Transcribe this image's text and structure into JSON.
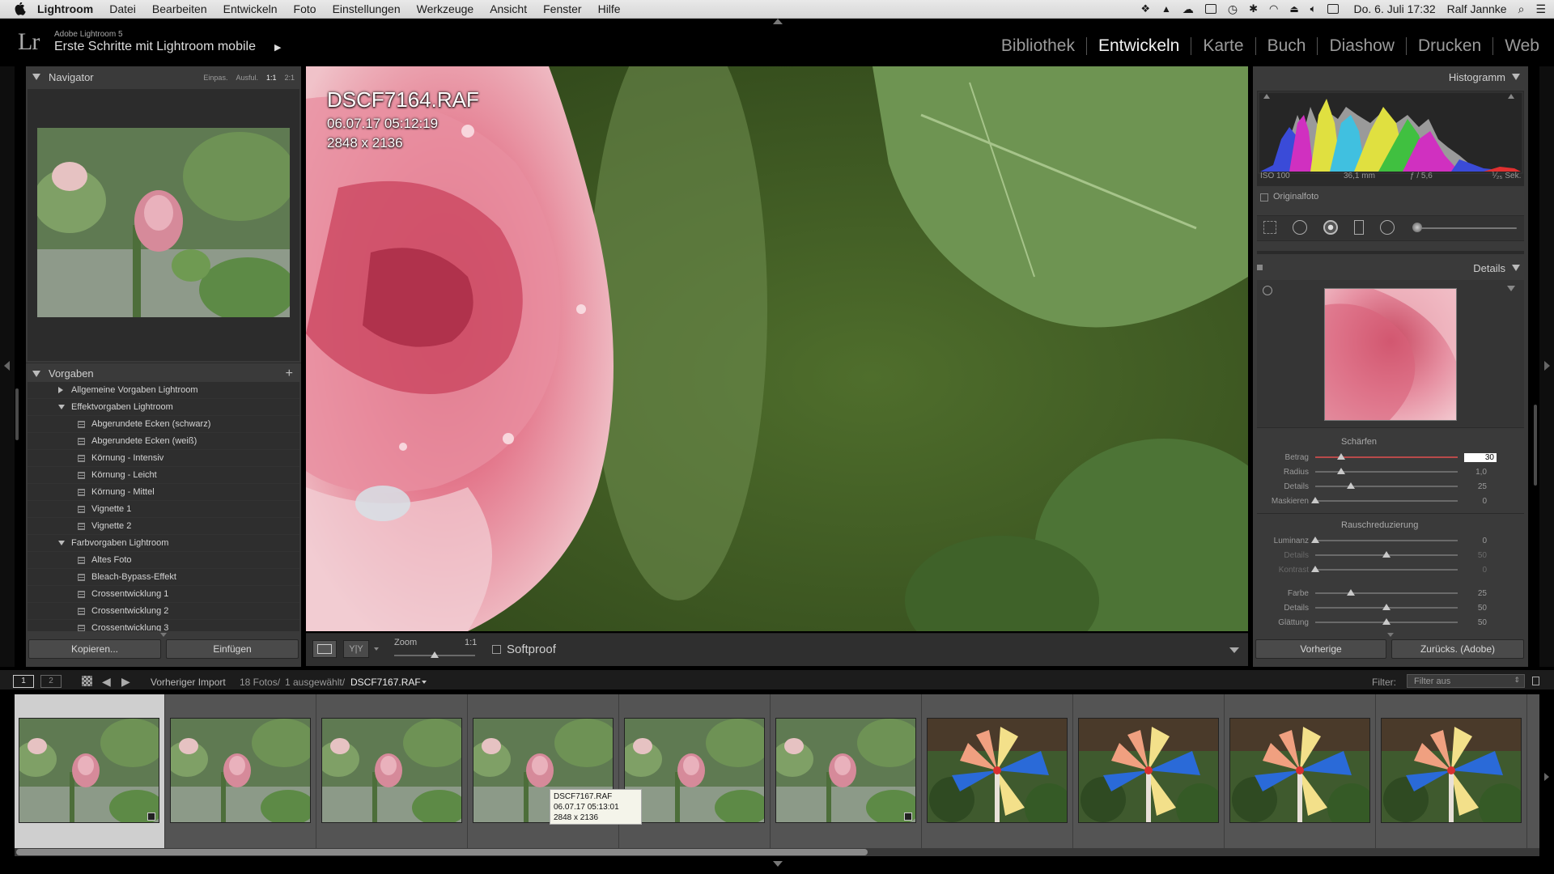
{
  "menubar": {
    "app_name": "Lightroom",
    "items": [
      "Datei",
      "Bearbeiten",
      "Entwickeln",
      "Foto",
      "Einstellungen",
      "Werkzeuge",
      "Ansicht",
      "Fenster",
      "Hilfe"
    ],
    "clock": "Do. 6. Juli  17:32",
    "user": "Ralf Jannke"
  },
  "identity": {
    "version": "Adobe Lightroom 5",
    "catalog": "Erste Schritte mit Lightroom mobile"
  },
  "modules": [
    {
      "label": "Bibliothek",
      "active": false
    },
    {
      "label": "Entwickeln",
      "active": true
    },
    {
      "label": "Karte",
      "active": false
    },
    {
      "label": "Buch",
      "active": false
    },
    {
      "label": "Diashow",
      "active": false
    },
    {
      "label": "Drucken",
      "active": false
    },
    {
      "label": "Web",
      "active": false
    }
  ],
  "navigator": {
    "title": "Navigator",
    "zoom_options": [
      "Einpas.",
      "Ausful.",
      "1:1",
      "2:1"
    ],
    "active_zoom": "1:1"
  },
  "presets": {
    "title": "Vorgaben",
    "add_symbol": "+",
    "items": [
      {
        "label": "Allgemeine Vorgaben Lightroom",
        "type": "folder",
        "open": false
      },
      {
        "label": "Effektvorgaben Lightroom",
        "type": "folder",
        "open": true
      },
      {
        "label": "Abgerundete Ecken (schwarz)",
        "type": "preset"
      },
      {
        "label": "Abgerundete Ecken (weiß)",
        "type": "preset"
      },
      {
        "label": "Körnung - Intensiv",
        "type": "preset"
      },
      {
        "label": "Körnung - Leicht",
        "type": "preset"
      },
      {
        "label": "Körnung - Mittel",
        "type": "preset"
      },
      {
        "label": "Vignette 1",
        "type": "preset"
      },
      {
        "label": "Vignette 2",
        "type": "preset"
      },
      {
        "label": "Farbvorgaben Lightroom",
        "type": "folder",
        "open": true
      },
      {
        "label": "Altes Foto",
        "type": "preset"
      },
      {
        "label": "Bleach-Bypass-Effekt",
        "type": "preset"
      },
      {
        "label": "Crossentwicklung 1",
        "type": "preset"
      },
      {
        "label": "Crossentwicklung 2",
        "type": "preset"
      },
      {
        "label": "Crossentwicklung 3",
        "type": "preset"
      }
    ]
  },
  "left_buttons": {
    "copy": "Kopieren...",
    "paste": "Einfügen"
  },
  "image_overlay": {
    "filename": "DSCF7164.RAF",
    "datetime": "06.07.17 05:12:19",
    "dimensions": "2848 x 2136"
  },
  "toolbar": {
    "zoom_label": "Zoom",
    "zoom_value": "1:1",
    "softproof_label": "Softproof",
    "zoom_slider_fraction": 0.5
  },
  "histogram": {
    "title": "Histogramm",
    "iso": "ISO 100",
    "focal": "36,1 mm",
    "aperture": "ƒ / 5,6",
    "shutter": "⅟₂₅ Sek.",
    "original_label": "Originalfoto"
  },
  "details": {
    "title": "Details",
    "sharpen_title": "Schärfen",
    "sharpen": [
      {
        "label": "Betrag",
        "value": "30",
        "fraction": 0.18
      },
      {
        "label": "Radius",
        "value": "1,0",
        "fraction": 0.18
      },
      {
        "label": "Details",
        "value": "25",
        "fraction": 0.25
      },
      {
        "label": "Maskieren",
        "value": "0",
        "fraction": 0.0
      }
    ],
    "noise_title": "Rauschreduzierung",
    "noise": [
      {
        "label": "Luminanz",
        "value": "0",
        "fraction": 0.0
      },
      {
        "label": "Details",
        "value": "50",
        "fraction": 0.5
      },
      {
        "label": "Kontrast",
        "value": "0",
        "fraction": 0.0
      },
      {
        "label": "Farbe",
        "value": "25",
        "fraction": 0.25
      },
      {
        "label": "Details",
        "value": "50",
        "fraction": 0.5
      },
      {
        "label": "Glättung",
        "value": "50",
        "fraction": 0.5
      }
    ]
  },
  "right_buttons": {
    "previous": "Vorherige",
    "reset": "Zurücks. (Adobe)"
  },
  "filmbar": {
    "screen1": "1",
    "screen2": "2",
    "source": "Vorheriger Import",
    "count": "18 Fotos/",
    "selected": "1 ausgewählt/",
    "current_file": "DSCF7167.RAF",
    "filter_label": "Filter:",
    "filter_value": "Filter aus"
  },
  "filmstrip": {
    "thumbs": [
      "rose",
      "rose",
      "rose",
      "rose",
      "rose",
      "rose",
      "pinwheel",
      "pinwheel",
      "pinwheel",
      "pinwheel"
    ],
    "selected_index": 0,
    "tooltip": {
      "filename": "DSCF7167.RAF",
      "datetime": "06.07.17 05:13:01",
      "dimensions": "2848 x 2136"
    }
  },
  "colors": {
    "accent": "#f2f2f2",
    "panel": "#3a3a3a",
    "background": "#000000"
  }
}
